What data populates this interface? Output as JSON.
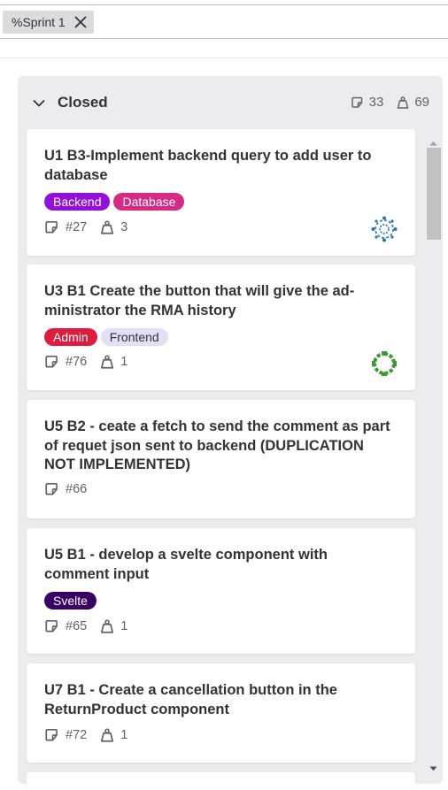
{
  "filter": {
    "token_label": "%Sprint 1"
  },
  "column": {
    "title": "Closed",
    "issue_count": "33",
    "weight_total": "69"
  },
  "cards": [
    {
      "title": "U1 B3-Implement backend query to add user to database",
      "labels": [
        {
          "text": "Backend",
          "bg": "#9210d9",
          "fg": "#ffffff"
        },
        {
          "text": "Database",
          "bg": "#d62a83",
          "fg": "#ffffff"
        }
      ],
      "issue_ref": "#27",
      "weight": "3",
      "avatar_color": "#1f78b4"
    },
    {
      "title": "U3 B1 Create the button that will give the ad-ministrator the RMA history",
      "labels": [
        {
          "text": "Admin",
          "bg": "#dd1c3f",
          "fg": "#ffffff"
        },
        {
          "text": "Frontend",
          "bg": "#e1e0f7",
          "fg": "#333238"
        }
      ],
      "issue_ref": "#76",
      "weight": "1",
      "avatar_color": "#3a9b2f"
    },
    {
      "title": "U5 B2 - ceate a fetch to send the comment as part of requet json sent to backend (DUPLICATION NOT IMPLEMENTED)",
      "labels": [],
      "issue_ref": "#66",
      "weight": ""
    },
    {
      "title": "U5 B1 - develop a svelte component with comment input",
      "labels": [
        {
          "text": "Svelte",
          "bg": "#380065",
          "fg": "#ffffff"
        }
      ],
      "issue_ref": "#65",
      "weight": "1"
    },
    {
      "title": "U7 B1 - Create a cancellation button in the ReturnProduct component",
      "labels": [],
      "issue_ref": "#72",
      "weight": "1"
    }
  ]
}
